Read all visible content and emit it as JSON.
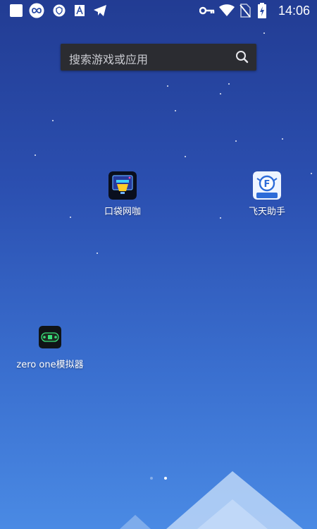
{
  "status_bar": {
    "time": "14:06",
    "left_icons": [
      "app-square-icon",
      "infinity-app-icon",
      "shield-app-icon",
      "font-app-icon",
      "telegram-send-icon"
    ],
    "right_icons": [
      "vpn-key-icon",
      "wifi-icon",
      "no-sim-icon",
      "battery-charging-icon"
    ]
  },
  "search": {
    "placeholder": "搜索游戏或应用"
  },
  "apps": [
    {
      "label": "口袋网咖"
    },
    {
      "label": "飞天助手"
    },
    {
      "label": "zero one模拟器"
    }
  ],
  "pages": {
    "count": 2,
    "current": 2
  },
  "colors": {
    "background_top": "#223c93",
    "background_bottom": "#4a8ae4",
    "search_bg": "#2b2c31"
  }
}
